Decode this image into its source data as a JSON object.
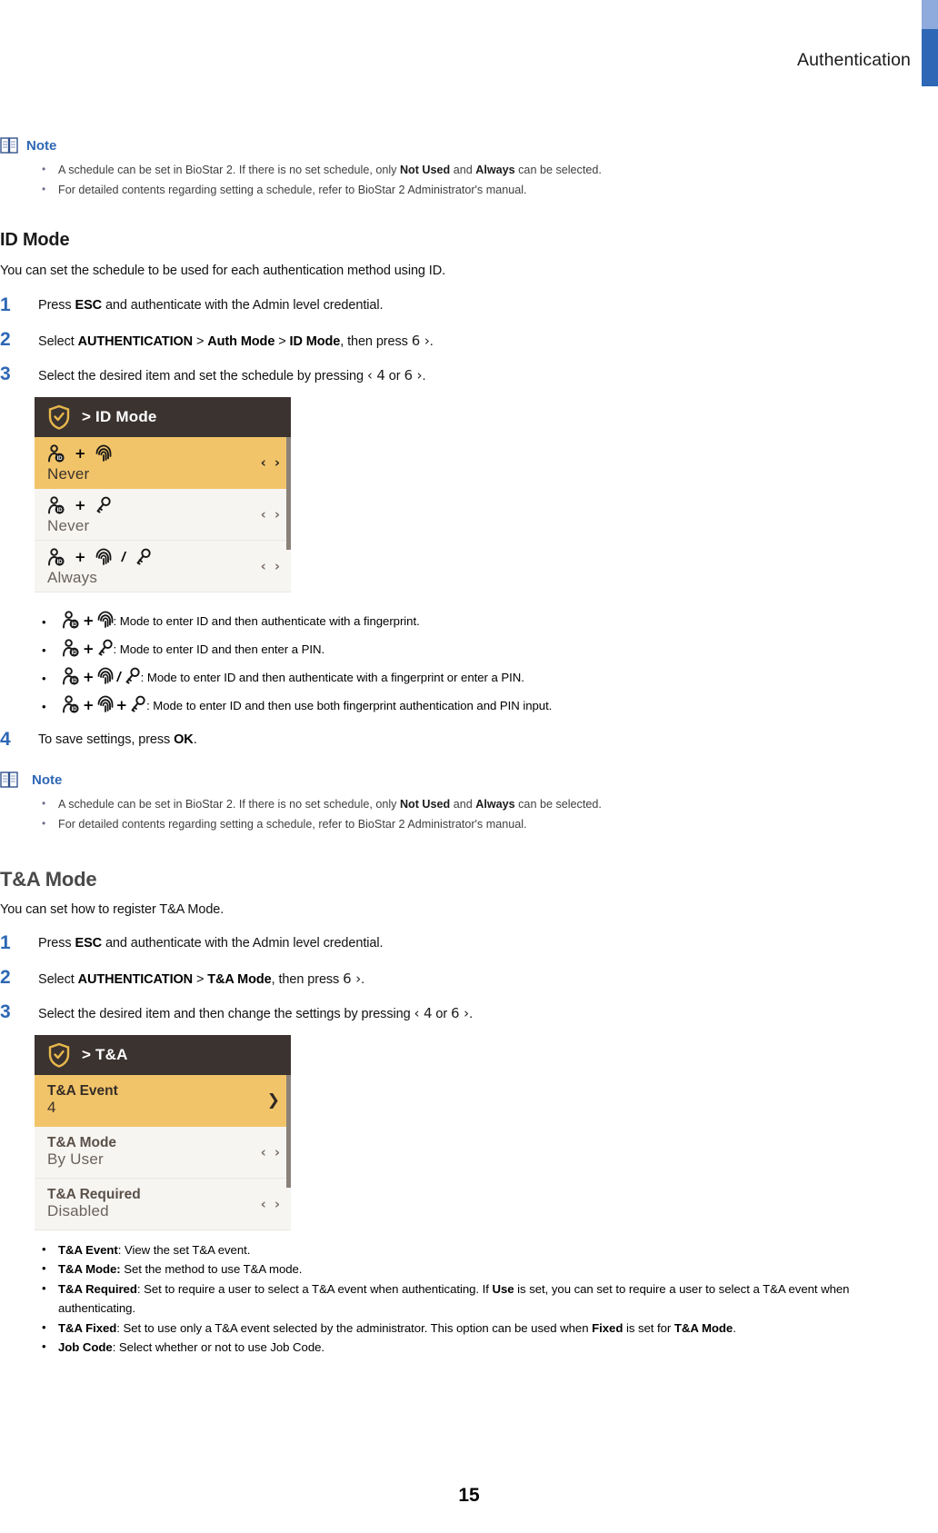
{
  "header": {
    "title": "Authentication",
    "accent_light": "#8faadc",
    "accent_dark": "#2e67b5"
  },
  "note_top": {
    "label": "Note",
    "icon": "book-note-icon",
    "items": [
      "A schedule can be set in BioStar 2. If there is no set schedule, only <b>Not Used</b> and <b>Always</b> can be selected.",
      "For detailed contents regarding setting a schedule, refer to BioStar 2 Administrator's manual."
    ]
  },
  "id_mode": {
    "title": "ID Mode",
    "description": "You can set the schedule to be used for each authentication method using ID.",
    "steps": [
      {
        "num": "1",
        "html": "Press <b>ESC</b> and authenticate with the Admin level credential."
      },
      {
        "num": "2",
        "html": "Select <b>AUTHENTICATION</b> &gt; <b>Auth Mode</b> &gt; <b>ID Mode</b>, then press <span class=\"key\">6 &rsaquo;</span>."
      },
      {
        "num": "3",
        "html": "Select the desired item and set the schedule by pressing <span class=\"key\">&lsaquo; 4</span> or <span class=\"key\">6 &rsaquo;</span>."
      }
    ],
    "device": {
      "title": "> ID Mode",
      "title_icon": "shield-check-icon",
      "rows": [
        {
          "icons": [
            "user-id-icon",
            "plus",
            "fingerprint-icon"
          ],
          "value": "Never",
          "arrows": "both",
          "selected": true
        },
        {
          "icons": [
            "user-id-icon",
            "plus",
            "key-icon"
          ],
          "value": "Never",
          "arrows": "both",
          "selected": false
        },
        {
          "icons": [
            "user-id-icon",
            "plus",
            "fingerprint-icon",
            "slash",
            "key-icon"
          ],
          "value": "Always",
          "arrows": "both",
          "selected": false
        }
      ]
    },
    "mode_bullets": [
      {
        "icons": [
          "user-id-icon",
          "plus",
          "fingerprint-icon"
        ],
        "text": ": Mode to enter ID and then authenticate with a fingerprint."
      },
      {
        "icons": [
          "user-id-icon",
          "plus",
          "key-icon"
        ],
        "text": ": Mode to enter ID and then enter a PIN."
      },
      {
        "icons": [
          "user-id-icon",
          "plus",
          "fingerprint-icon",
          "slash",
          "key-icon"
        ],
        "text": ": Mode to enter ID and then authenticate with a fingerprint or enter a PIN."
      },
      {
        "icons": [
          "user-id-icon",
          "plus",
          "fingerprint-icon",
          "plus",
          "key-icon"
        ],
        "text": ": Mode to enter ID and then use both fingerprint authentication and PIN input."
      }
    ],
    "save_step": {
      "num": "4",
      "html": "To save settings, press <b>OK</b>."
    }
  },
  "note_bottom": {
    "label": "Note",
    "icon": "book-note-icon",
    "items": [
      "A schedule can be set in BioStar 2. If there is no set schedule, only <b>Not Used</b> and <b>Always</b> can be selected.",
      "For detailed contents regarding setting a schedule, refer to BioStar 2 Administrator's manual."
    ]
  },
  "ta_mode": {
    "title": "T&A Mode",
    "description": "You can set how to register T&A Mode.",
    "steps": [
      {
        "num": "1",
        "html": "Press <b>ESC</b> and authenticate with the Admin level credential."
      },
      {
        "num": "2",
        "html": "Select <b>AUTHENTICATION</b> &gt; <b>T&amp;A Mode</b>, then press <span class=\"key\">6 &rsaquo;</span>."
      },
      {
        "num": "3",
        "html": "Select the desired item and then change the settings by pressing <span class=\"key\">&lsaquo; 4</span> or <span class=\"key\">6 &rsaquo;</span>."
      }
    ],
    "device": {
      "title": "> T&A",
      "title_icon": "shield-check-icon",
      "rows": [
        {
          "label": "T&A Event",
          "value": "4",
          "arrows": "single",
          "selected": true
        },
        {
          "label": "T&A Mode",
          "value": "By User",
          "arrows": "both",
          "selected": false
        },
        {
          "label": "T&A Required",
          "value": "Disabled",
          "arrows": "both",
          "selected": false
        }
      ]
    },
    "bullets": [
      "<b>T&amp;A Event</b>: View the set T&amp;A event.",
      "<b>T&amp;A Mode:</b> Set the method to use T&amp;A mode.",
      "<b>T&amp;A Required</b>: Set to require a user to select a T&amp;A event when authenticating. If <b>Use</b> is set, you can set to require a user to select a T&amp;A event when authenticating.",
      "<b>T&amp;A Fixed</b>: Set to use only a T&amp;A event selected by the administrator. This option can be used when <b>Fixed</b> is set for <b>T&amp;A Mode</b>.",
      "<b>Job Code</b>: Select whether or not to use Job Code."
    ]
  },
  "footer": {
    "page_number": "15"
  }
}
